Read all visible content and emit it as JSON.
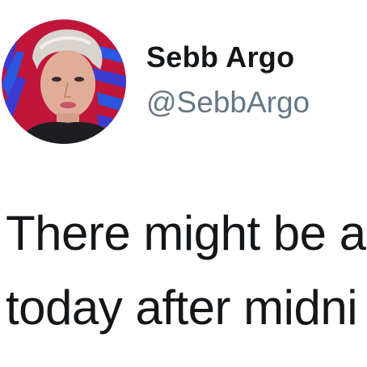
{
  "user": {
    "display_name": "Sebb Argo",
    "handle": "@SebbArgo"
  },
  "tweet": {
    "lines": [
      "There might be a",
      "today after midni"
    ]
  },
  "colors": {
    "text_primary": "#14171a",
    "text_secondary": "#657786",
    "background": "#ffffff"
  }
}
